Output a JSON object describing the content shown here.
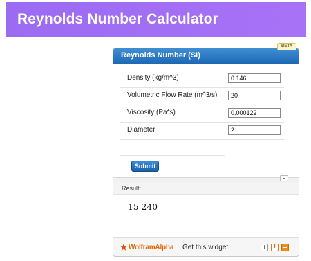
{
  "page": {
    "title": "Reynolds Number Calculator"
  },
  "widget": {
    "badge": "BETA",
    "title": "Reynolds Number (SI)",
    "fields": [
      {
        "label": "Density (kg/m^3)",
        "value": "0.146"
      },
      {
        "label": "Volumetric Flow Rate (m^3/s)",
        "value": "20"
      },
      {
        "label": "Viscosity (Pa*s)",
        "value": "0.000122"
      },
      {
        "label": "Diameter",
        "value": "2"
      }
    ],
    "submit_label": "Submit",
    "result_label": "Result:",
    "result_value": "15 240",
    "footer": {
      "brand": "WolframAlpha",
      "get_widget": "Get this widget",
      "info_icon_glyph": "i",
      "plus_icon_glyph": "+"
    }
  },
  "colors": {
    "header_purple": "#a06ef4",
    "widget_blue": "#1e68b4",
    "brand_orange": "#e46a00"
  },
  "icons": [
    "wolfram-star-icon",
    "info-icon",
    "add-icon",
    "menu-icon",
    "collapse-icon"
  ]
}
